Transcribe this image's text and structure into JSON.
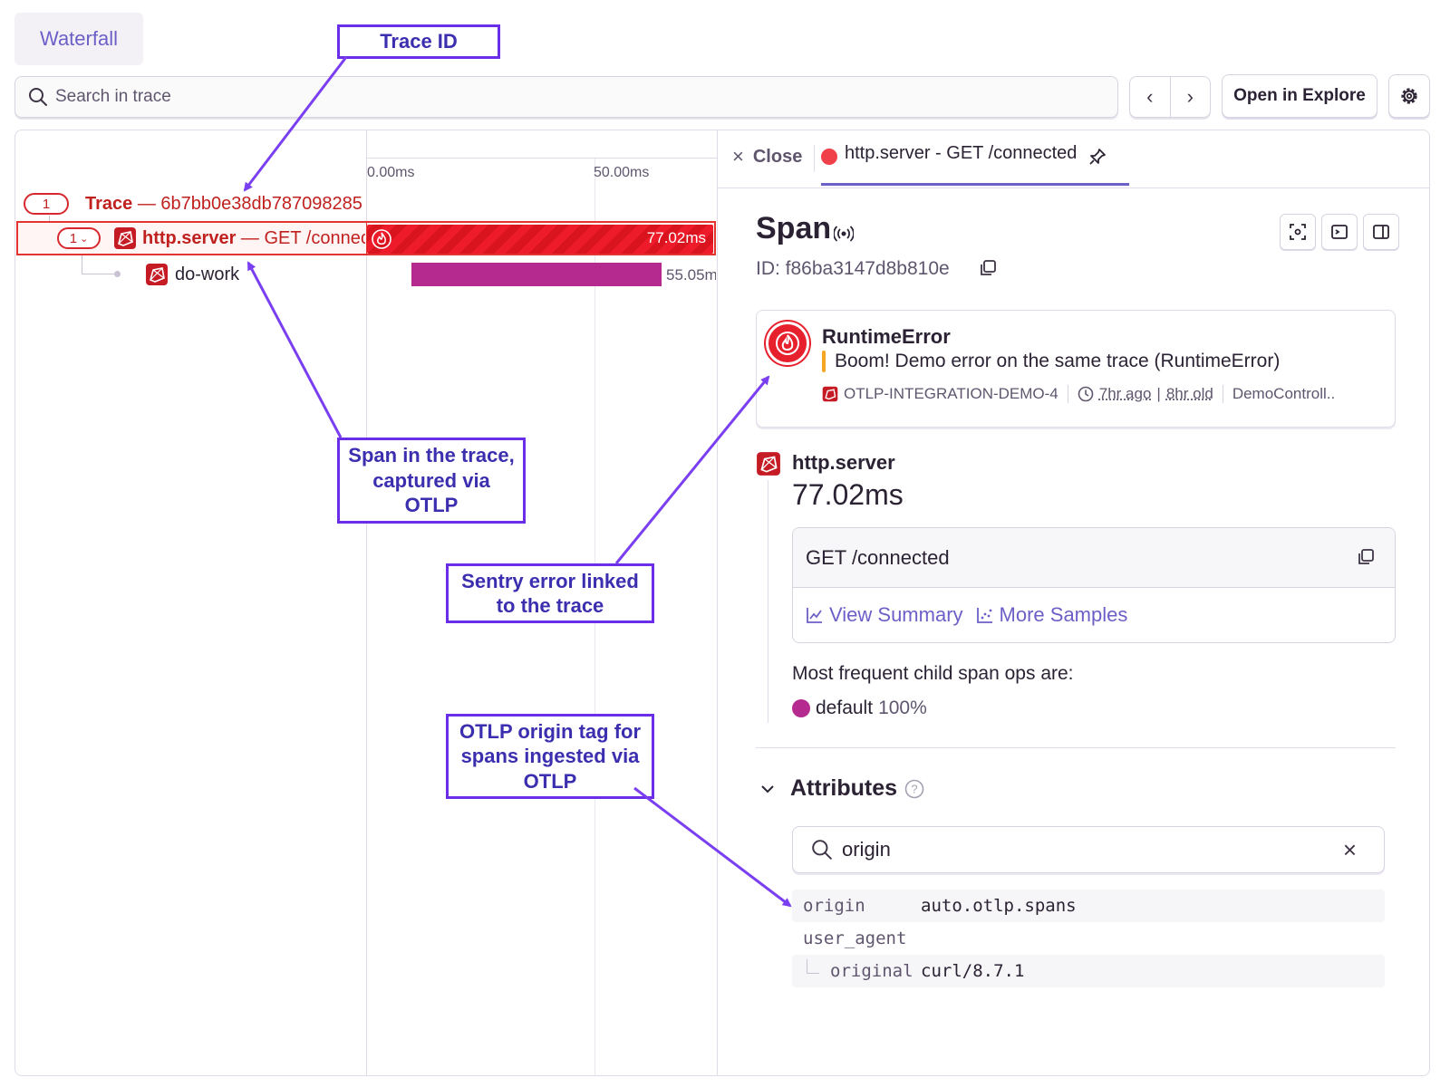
{
  "toolbar": {
    "tab": "Waterfall",
    "search_placeholder": "Search in trace",
    "prev": "‹",
    "next": "›",
    "open_explore": "Open in Explore"
  },
  "timeline": {
    "ticks": [
      "0.00ms",
      "50.00ms"
    ]
  },
  "tree": {
    "trace_pill": "1",
    "trace_label_bold": "Trace",
    "trace_label_rest": " — 6b7bb0e38db787098285",
    "span_pill": "1",
    "span_op": "http.server",
    "span_desc": " — GET /connec",
    "child_name": "do-work",
    "span_duration": "77.02ms",
    "child_duration": "55.05m"
  },
  "detail": {
    "close": "Close",
    "tab_label": "http.server - GET /connected",
    "title": "Span",
    "id_label": "ID: f86ba3147d8b810e",
    "error": {
      "title": "RuntimeError",
      "message": "Boom! Demo error on the same trace (RuntimeError)",
      "project": "OTLP-INTEGRATION-DEMO-4",
      "age": "7hr ago",
      "old": "8hr old",
      "culprit": "DemoControll.."
    },
    "op": "http.server",
    "duration": "77.02ms",
    "description": "GET /connected",
    "view_summary": "View Summary",
    "more_samples": "More Samples",
    "child_ops_title": "Most frequent child span ops are:",
    "child_op_name": "default",
    "child_op_pct": "100%",
    "attributes_title": "Attributes",
    "attr_search_value": "origin",
    "attrs": [
      {
        "key": "origin",
        "value": "auto.otlp.spans"
      },
      {
        "key": "user_agent",
        "value": ""
      },
      {
        "key": "original",
        "value": "curl/8.7.1"
      }
    ]
  },
  "annotations": {
    "trace_id": "Trace ID",
    "span_trace": "Span in the trace, captured via OTLP",
    "error_link": "Sentry error linked to the trace",
    "otlp_tag": "OTLP origin tag for spans ingested via OTLP"
  },
  "colors": {
    "accent": "#6c5fc7",
    "error_red": "#e3342f",
    "child_bar": "#b42a8e",
    "annotation": "#6a2ee8"
  },
  "icons": [
    "search-icon",
    "chevron-left-icon",
    "chevron-right-icon",
    "gear-icon",
    "close-icon",
    "pin-icon",
    "signal-icon",
    "copy-icon",
    "focus-icon",
    "terminal-icon",
    "sidebar-icon",
    "fire-icon",
    "clock-icon",
    "ruby-icon",
    "chart-icon",
    "scatter-icon",
    "chevron-down-icon",
    "help-icon"
  ]
}
